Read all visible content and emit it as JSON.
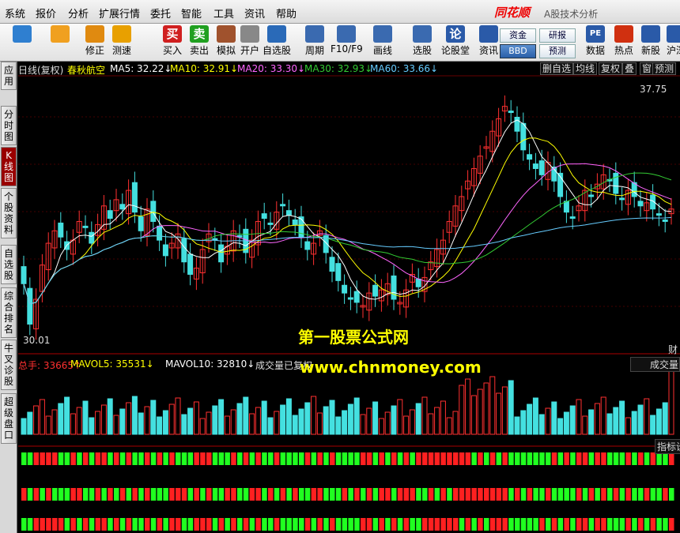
{
  "menu": [
    "系统",
    "报价",
    "分析",
    "扩展行情",
    "委托",
    "智能",
    "工具",
    "资讯",
    "帮助"
  ],
  "brand": {
    "logo": "同花顺",
    "subtitle": "A股技术分析"
  },
  "toolbar": {
    "buttons": [
      {
        "label": "",
        "icon": "grid-icon",
        "color": "#2f7fd0"
      },
      {
        "label": "",
        "icon": "back-arrow-icon",
        "color": "#f0a020"
      },
      {
        "label": "修正",
        "icon": "updown-arrows-icon",
        "color": "#e08a10"
      },
      {
        "label": "测速",
        "icon": "speed-icon",
        "color": "#e8a000"
      },
      {
        "label": "买入",
        "icon": "buy-icon",
        "color": "#d02020",
        "glyph": "买"
      },
      {
        "label": "卖出",
        "icon": "sell-icon",
        "color": "#20a020",
        "glyph": "卖"
      },
      {
        "label": "模拟",
        "icon": "hammer-icon",
        "color": "#a0522d"
      },
      {
        "label": "开户",
        "icon": "lock-icon",
        "color": "#888"
      },
      {
        "label": "自选股",
        "icon": "star-icon",
        "color": "#2a6ab8"
      },
      {
        "label": "周期",
        "icon": "clock-icon",
        "color": "#3a6ab0"
      },
      {
        "label": "F10/F9",
        "icon": "f10-icon",
        "color": "#3a6ab0"
      },
      {
        "label": "画线",
        "icon": "pencil-icon",
        "color": "#3a6ab0"
      },
      {
        "label": "选股",
        "icon": "filter-icon",
        "color": "#3a6ab0"
      },
      {
        "label": "论股堂",
        "icon": "forum-icon",
        "color": "#2a5aa8",
        "glyph": "论"
      },
      {
        "label": "资讯",
        "icon": "news-icon",
        "color": "#2a5aa8"
      }
    ],
    "pills": [
      "资金",
      "研报",
      "BBD",
      "预测"
    ],
    "right_buttons": [
      {
        "label": "数据",
        "icon": "pe-icon",
        "color": "#2a5aa8",
        "glyph": "PE"
      },
      {
        "label": "热点",
        "icon": "hot-icon",
        "color": "#d03010"
      },
      {
        "label": "新股",
        "icon": "ipo-icon",
        "color": "#2a5aa8"
      },
      {
        "label": "沪深",
        "icon": "hs-icon",
        "color": "#2a5aa8"
      }
    ]
  },
  "left_tabs": [
    {
      "label": "应用",
      "active": false
    },
    {
      "label": "分时图",
      "active": false
    },
    {
      "label": "K线图",
      "active": true
    },
    {
      "label": "个股资料",
      "active": false
    },
    {
      "label": "自选股",
      "active": false
    },
    {
      "label": "综合排名",
      "active": false
    },
    {
      "label": "牛叉诊股",
      "active": false
    },
    {
      "label": "超级盘口",
      "active": false
    }
  ],
  "chart_header": {
    "period": "日线(复权)",
    "stock": "春秋航空",
    "ma": [
      {
        "text": "MA5: 32.22",
        "color": "#ffffff"
      },
      {
        "text": "MA10: 32.91",
        "color": "#ffff00"
      },
      {
        "text": "MA20: 33.30",
        "color": "#ff66ff"
      },
      {
        "text": "MA30: 32.93",
        "color": "#33cc33"
      },
      {
        "text": "MA60: 33.66",
        "color": "#66ccff"
      }
    ],
    "right_buttons": [
      "删自选",
      "均线",
      "复权",
      "叠",
      "窗",
      "预测"
    ]
  },
  "price_labels": {
    "high": "37.75",
    "low": "30.01",
    "right_edge": "财"
  },
  "volume_header": {
    "total": "总手: 33665",
    "mavol5": "MAVOL5: 35531",
    "mavol10": "MAVOL10: 32810",
    "note": "成交量已复权",
    "right": "成交量"
  },
  "indicator_label": "指标设",
  "watermark": {
    "line1": "第一股票公式网",
    "line2": "www.chnmoney.com"
  },
  "colors": {
    "up": "#ff3030",
    "down": "#44e0e0",
    "bull": "#ff2020",
    "bear": "#20ff20"
  },
  "chart_data": {
    "type": "candlestick",
    "price_range": [
      30.01,
      37.75
    ],
    "closes": [
      31.5,
      30.2,
      31.0,
      32.1,
      32.8,
      33.2,
      33.0,
      32.6,
      32.9,
      33.5,
      33.3,
      32.8,
      33.4,
      34.0,
      33.6,
      34.2,
      33.9,
      34.5,
      33.8,
      33.2,
      33.9,
      33.5,
      32.9,
      32.4,
      32.8,
      33.1,
      32.2,
      31.8,
      32.0,
      32.6,
      33.1,
      32.9,
      32.2,
      32.7,
      33.2,
      33.0,
      32.5,
      32.9,
      33.5,
      33.6,
      33.4,
      33.8,
      34.0,
      33.7,
      33.4,
      33.0,
      32.6,
      32.8,
      33.2,
      32.5,
      31.9,
      31.6,
      31.2,
      31.0,
      30.9,
      30.8,
      31.2,
      31.1,
      31.3,
      31.5,
      31.0,
      30.9,
      31.3,
      31.8,
      31.4,
      31.7,
      32.2,
      32.6,
      32.9,
      33.5,
      34.0,
      34.3,
      34.8,
      35.2,
      35.6,
      35.9,
      36.4,
      36.8,
      37.2,
      37.0,
      36.4,
      35.8,
      35.5,
      35.2,
      35.0,
      35.4,
      34.8,
      34.3,
      33.8,
      33.6,
      34.0,
      34.5,
      34.3,
      34.7,
      35.0,
      34.8,
      34.4,
      34.2,
      34.5,
      34.3,
      34.0,
      34.1,
      33.9,
      33.7,
      33.5,
      33.9
    ]
  }
}
